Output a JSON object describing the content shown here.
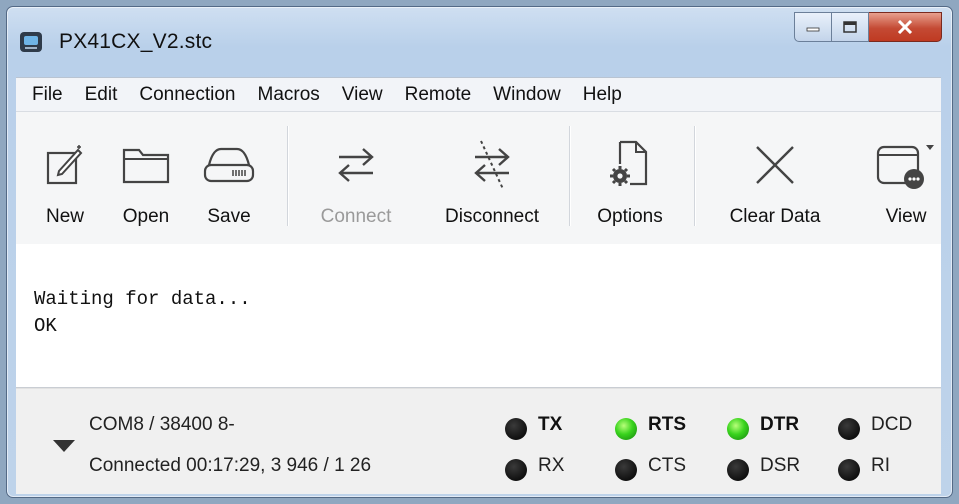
{
  "window": {
    "title": "PX41CX_V2.stc"
  },
  "menu": [
    "File",
    "Edit",
    "Connection",
    "Macros",
    "View",
    "Remote",
    "Window",
    "Help"
  ],
  "toolbar": {
    "new": "New",
    "open": "Open",
    "save": "Save",
    "connect": "Connect",
    "disconnect": "Disconnect",
    "options": "Options",
    "clear_data": "Clear Data",
    "view": "View"
  },
  "terminal": {
    "lines": [
      "Waiting for data...",
      "OK"
    ]
  },
  "status": {
    "line1": "COM8 / 38400 8-",
    "line2": "Connected 00:17:29, 3 946 / 1 26"
  },
  "signals": {
    "tx": {
      "label": "TX",
      "on": false
    },
    "rx": {
      "label": "RX",
      "on": false
    },
    "rts": {
      "label": "RTS",
      "on": true
    },
    "cts": {
      "label": "CTS",
      "on": false
    },
    "dtr": {
      "label": "DTR",
      "on": true
    },
    "dsr": {
      "label": "DSR",
      "on": false
    },
    "dcd": {
      "label": "DCD",
      "on": false
    },
    "ri": {
      "label": "RI",
      "on": false
    }
  },
  "colors": {
    "led_on": "#39d31d",
    "led_off": "#101010",
    "close_button": "#c44a34"
  }
}
